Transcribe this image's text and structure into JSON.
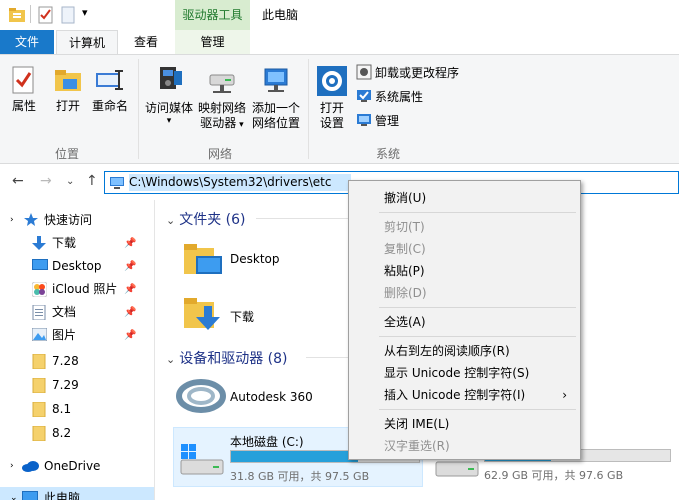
{
  "quick_access": {
    "dropdown_glyph": "▾"
  },
  "title": {
    "tool_header": "驱动器工具",
    "window_title": "此电脑"
  },
  "tabs": {
    "file": "文件",
    "computer": "计算机",
    "view": "查看",
    "manage": "管理"
  },
  "ribbon": {
    "properties": "属性",
    "open": "打开",
    "rename": "重命名",
    "group_location": "位置",
    "access_media": "访问媒体",
    "map_drive_1": "映射网络",
    "map_drive_2": "驱动器",
    "add_location_1": "添加一个",
    "add_location_2": "网络位置",
    "group_network": "网络",
    "open_settings_1": "打开",
    "open_settings_2": "设置",
    "uninstall": "卸载或更改程序",
    "system_properties": "系统属性",
    "manage": "管理",
    "group_system": "系统"
  },
  "address": {
    "path": "C:\\Windows\\System32\\drivers\\etc"
  },
  "sidebar": {
    "items": [
      {
        "label": "快速访问"
      },
      {
        "label": "下载"
      },
      {
        "label": "Desktop"
      },
      {
        "label": "iCloud 照片"
      },
      {
        "label": "文档"
      },
      {
        "label": "图片"
      },
      {
        "label": "7.28"
      },
      {
        "label": "7.29"
      },
      {
        "label": "8.1"
      },
      {
        "label": "8.2"
      },
      {
        "label": "OneDrive"
      },
      {
        "label": "此电脑"
      }
    ]
  },
  "content": {
    "folders_header": "文件夹 (6)",
    "folders": [
      {
        "name": "Desktop"
      },
      {
        "name": "下载"
      }
    ],
    "devices_header": "设备和驱动器 (8)",
    "autodesk": "Autodesk 360",
    "drive_c": {
      "name": "本地磁盘 (C:)",
      "free_text": "31.8 GB 可用，共 97.5 GB",
      "used_fraction": 0.674
    },
    "drive_2": {
      "free_text": "62.9 GB 可用，共 97.6 GB",
      "used_fraction": 0.356
    }
  },
  "context_menu": {
    "items": [
      {
        "label": "撤消(U)",
        "enabled": true
      },
      {
        "label": "剪切(T)",
        "enabled": false
      },
      {
        "label": "复制(C)",
        "enabled": false
      },
      {
        "label": "粘贴(P)",
        "enabled": true
      },
      {
        "label": "删除(D)",
        "enabled": false
      },
      {
        "label": "全选(A)",
        "enabled": true
      },
      {
        "label": "从右到左的阅读顺序(R)",
        "enabled": true
      },
      {
        "label": "显示 Unicode 控制字符(S)",
        "enabled": true
      },
      {
        "label": "插入 Unicode 控制字符(I)",
        "enabled": true,
        "submenu_arrow": "›"
      },
      {
        "label": "关闭 IME(L)",
        "enabled": true
      },
      {
        "label": "汉字重选(R)",
        "enabled": false
      }
    ]
  },
  "colors": {
    "accent": "#0078d7",
    "file_tab": "#1979ca",
    "drive_bar": "#26a0da",
    "selection": "#cce8ff",
    "section_header": "#1e3287"
  }
}
